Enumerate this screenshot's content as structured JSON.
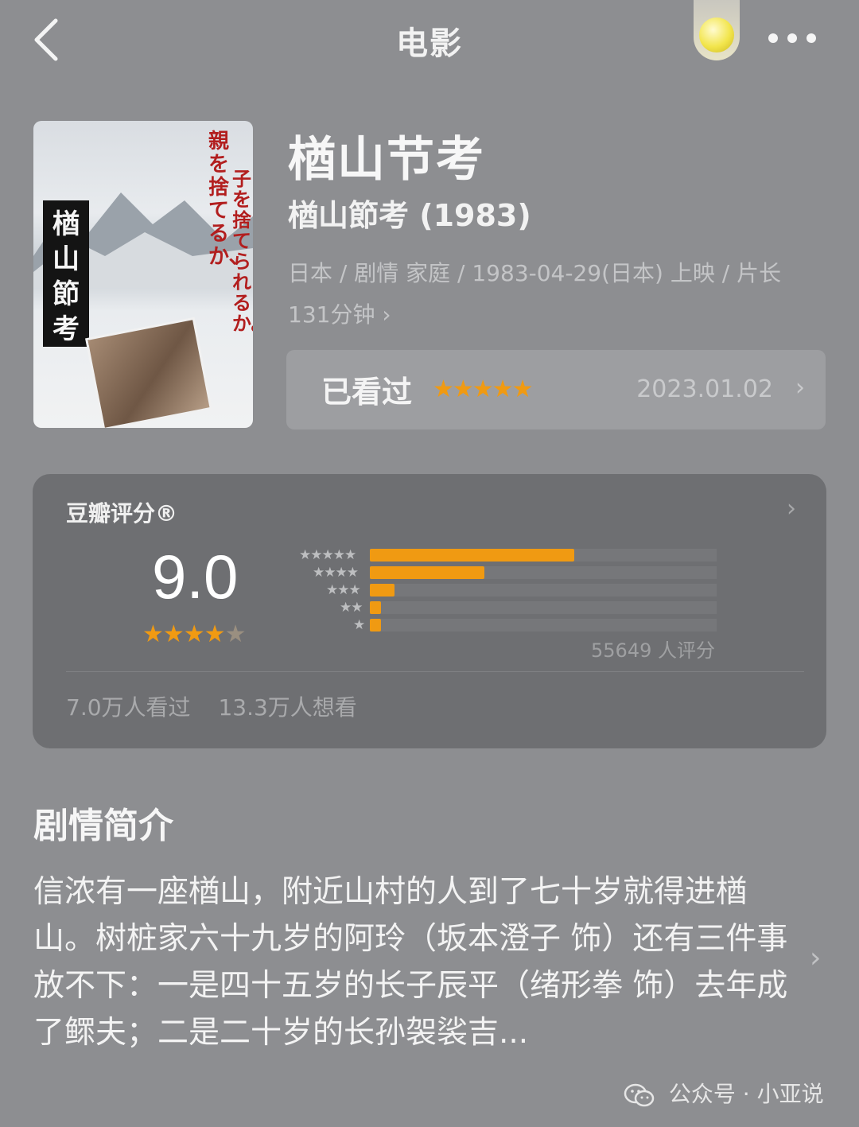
{
  "nav": {
    "title": "电影",
    "back_icon": "chevron-left-icon",
    "coin_icon": "gold-coin-icon",
    "more_icon": "more-dots-icon"
  },
  "movie": {
    "title": "楢山节考",
    "original_title": "楢山節考 (1983)",
    "meta_line": "日本 / 剧情 家庭 / 1983-04-29(日本) 上映 / 片长 131分钟",
    "meta_chevron": "›",
    "poster": {
      "band_text": "楢山節考",
      "red_text_1": "親を捨てるか、",
      "red_text_2": "子を捨てられるか。"
    }
  },
  "watched": {
    "label": "已看过",
    "stars": "★★★★★",
    "date": "2023.01.02",
    "chevron": "›",
    "star_color": "#f09a12"
  },
  "rating": {
    "title": "豆瓣评分®",
    "chevron": "›",
    "score": "9.0",
    "stars": "★★★★",
    "half_star": "★",
    "distribution": [
      {
        "stars": "★★★★★",
        "fraction": 0.59
      },
      {
        "stars": "★★★★",
        "fraction": 0.33
      },
      {
        "stars": "★★★",
        "fraction": 0.07
      },
      {
        "stars": "★★",
        "fraction": 0.03
      },
      {
        "stars": "★",
        "fraction": 0.03
      }
    ],
    "count": "55649 人评分",
    "watched_count": "7.0万人看过",
    "want_count": "13.3万人想看",
    "accent_color": "#f09a12"
  },
  "synopsis": {
    "heading": "剧情简介",
    "text": "信浓有一座楢山，附近山村的人到了七十岁就得进楢山。树桩家六十九岁的阿玲（坂本澄子 饰）还有三件事放不下：一是四十五岁的长子辰平（绪形拳 饰）去年成了鳏夫；二是二十岁的长孙袈裟吉...",
    "chevron": "›"
  },
  "watermark": {
    "text": "公众号 · 小亚说",
    "icon": "wechat-icon"
  }
}
